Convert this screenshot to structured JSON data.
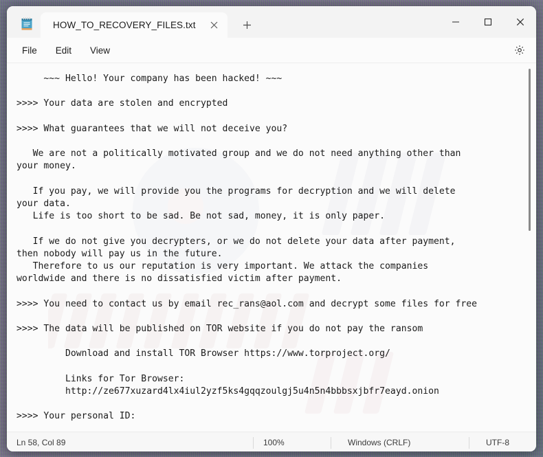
{
  "window": {
    "app_icon": "notepad-icon",
    "controls": {
      "minimize": "—",
      "maximize": "□",
      "close": "✕"
    }
  },
  "tabs": {
    "active": {
      "title": "HOW_TO_RECOVERY_FILES.txt",
      "close_label": "✕"
    },
    "new_tab_label": "+"
  },
  "menubar": {
    "items": [
      {
        "label": "File"
      },
      {
        "label": "Edit"
      },
      {
        "label": "View"
      }
    ],
    "settings_icon": "gear-icon"
  },
  "document": {
    "filename": "HOW_TO_RECOVERY_FILES.txt",
    "lines": [
      "     ~~~ Hello! Your company has been hacked! ~~~",
      "",
      ">>>> Your data are stolen and encrypted",
      "",
      ">>>> What guarantees that we will not deceive you?",
      "",
      "   We are not a politically motivated group and we do not need anything other than",
      "your money.",
      "",
      "   If you pay, we will provide you the programs for decryption and we will delete",
      "your data.",
      "   Life is too short to be sad. Be not sad, money, it is only paper.",
      "",
      "   If we do not give you decrypters, or we do not delete your data after payment,",
      "then nobody will pay us in the future.",
      "   Therefore to us our reputation is very important. We attack the companies",
      "worldwide and there is no dissatisfied victim after payment.",
      "",
      ">>>> You need to contact us by email rec_rans@aol.com and decrypt some files for free",
      "",
      ">>>> The data will be published on TOR website if you do not pay the ransom",
      "",
      "         Download and install TOR Browser https://www.torproject.org/",
      "",
      "         Links for Tor Browser:",
      "         http://ze677xuzard4lx4iul2yzf5ks4gqqzoulgj5u4n5n4bbbsxjbfr7eayd.onion",
      "",
      ">>>> Your personal ID:"
    ],
    "contact_email": "rec_rans@aol.com",
    "tor_browser_url": "https://www.torproject.org/",
    "onion_url": "http://ze677xuzard4lx4iul2yzf5ks4gqqzoulgj5u4n5n4bbbsxjbfr7eayd.onion"
  },
  "statusbar": {
    "position": "Ln 58, Col 89",
    "zoom": "100%",
    "line_ending": "Windows (CRLF)",
    "encoding": "UTF-8"
  },
  "colors": {
    "window_bg": "#fbfbfb",
    "titlebar_bg": "#f3f3f3",
    "text": "#1a1a1a",
    "statusbar_bg": "#f7f7f7",
    "close_hover": "#e81123"
  }
}
